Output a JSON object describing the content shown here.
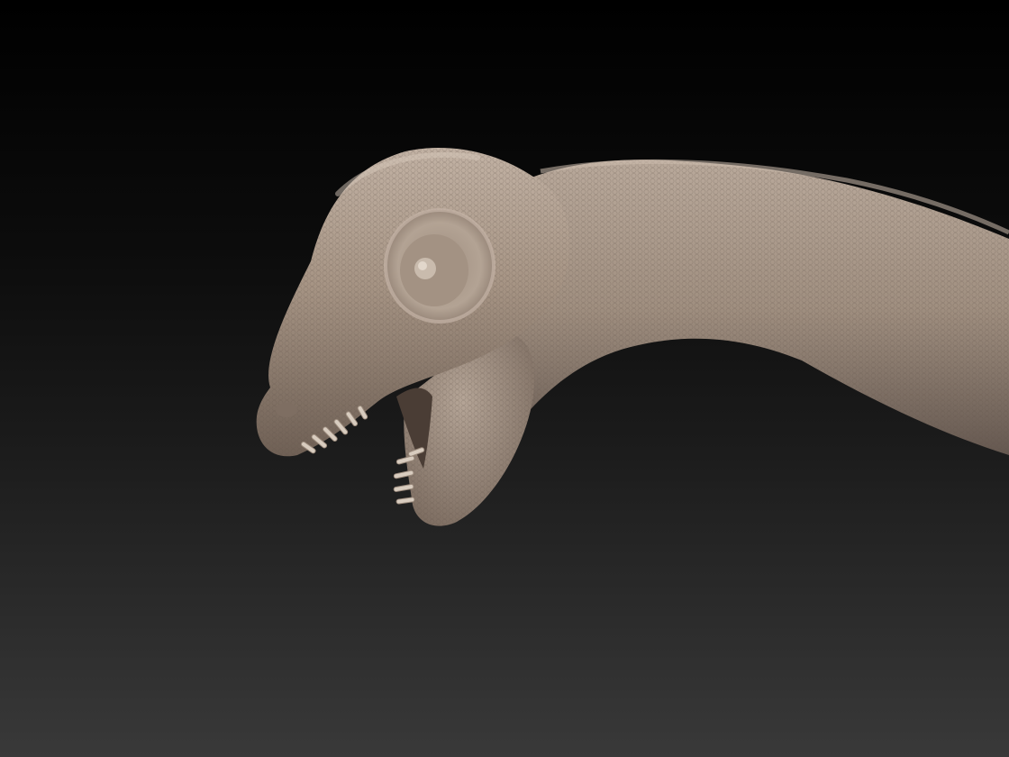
{
  "scene": {
    "subject_icon": "sauropod-head-sculpt-icon",
    "colors": {
      "background_top": "#000000",
      "background_bottom": "#393939",
      "skin_light": "#b8a89a",
      "skin_mid": "#9c8b7d",
      "skin_dark": "#6e5f54",
      "teeth": "#d8ccbf",
      "mouth_interior": "#4a3d35"
    }
  }
}
